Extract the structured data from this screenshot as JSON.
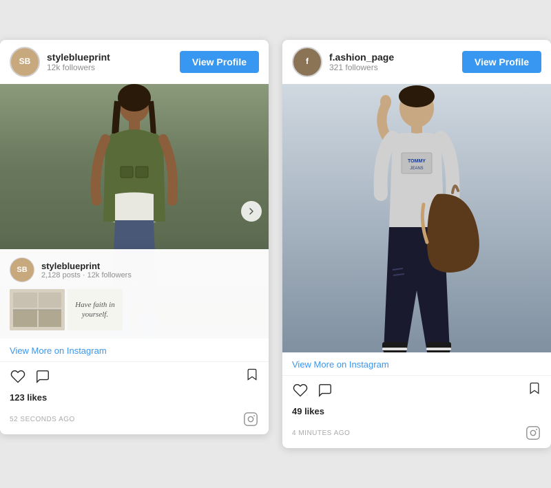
{
  "card1": {
    "avatar_initials": "SB",
    "username": "styleblueprint",
    "followers": "12k followers",
    "view_profile_label": "View Profile",
    "popup": {
      "username": "styleblueprint",
      "stats": "2,128 posts · 12k followers",
      "quote": "Have faith in yourself."
    },
    "view_more_label": "View More on Instagram",
    "likes": "123 likes",
    "timestamp": "52 SECONDS AGO"
  },
  "card2": {
    "avatar_initials": "f",
    "username": "f.ashion_page",
    "followers": "321 followers",
    "view_profile_label": "View Profile",
    "view_more_label": "View More on Instagram",
    "likes": "49 likes",
    "timestamp": "4 MINUTES AGO"
  }
}
